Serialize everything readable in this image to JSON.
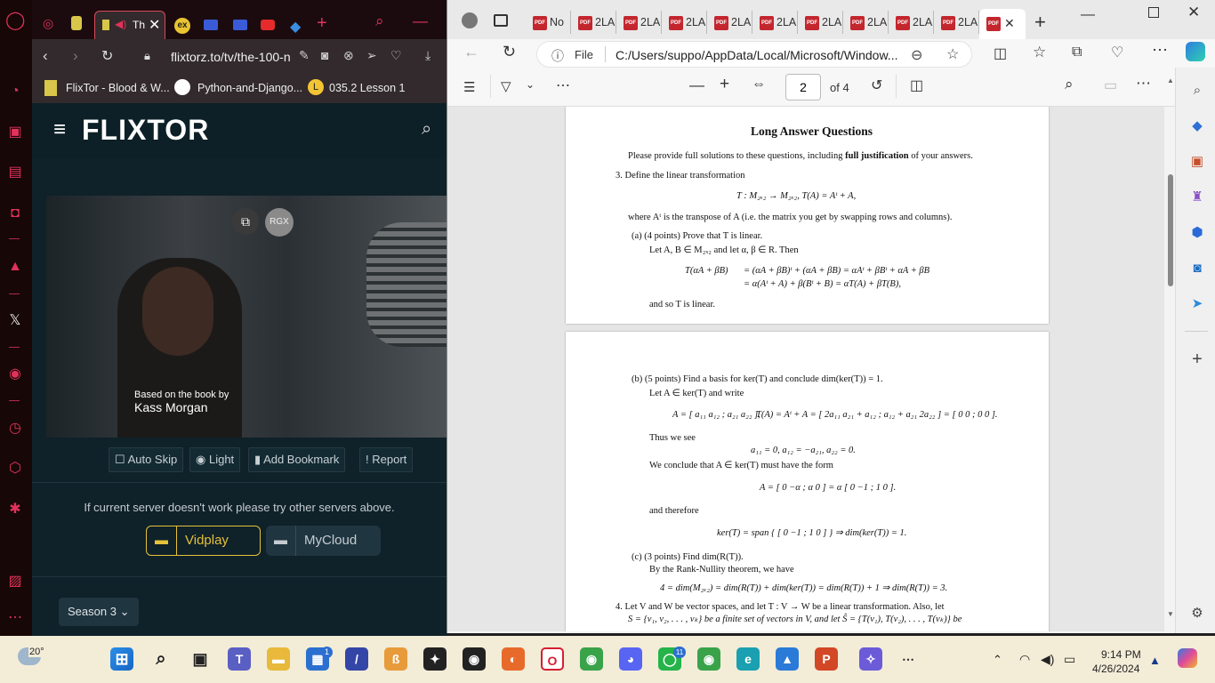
{
  "opera": {
    "tab_active_label": "Th",
    "address": "flixtorz.to/tv/the-100-n",
    "bookmarks": [
      {
        "label": "FlixTor - Blood & W..."
      },
      {
        "label": "Python-and-Django..."
      },
      {
        "label": "035.2 Lesson 1"
      }
    ]
  },
  "flixtor": {
    "logo": "FLIXTOR",
    "video": {
      "credit_line1": "Based on the book by",
      "credit_line2": "Kass Morgan",
      "badge": "RGX"
    },
    "controls": {
      "auto_skip": "Auto Skip",
      "light": "Light",
      "add_bookmark": "Add Bookmark",
      "report": "Report"
    },
    "server_notice": "If current server doesn't work please try other servers above.",
    "servers": [
      {
        "label": "Vidplay",
        "active": true
      },
      {
        "label": "MyCloud",
        "active": false
      }
    ],
    "season_select": "Season 3"
  },
  "edge": {
    "tabs": [
      {
        "label": "No"
      },
      {
        "label": "2LA"
      },
      {
        "label": "2LA"
      },
      {
        "label": "2LA"
      },
      {
        "label": "2LA"
      },
      {
        "label": "2LA"
      },
      {
        "label": "2LA"
      },
      {
        "label": "2LA"
      },
      {
        "label": "2LA"
      },
      {
        "label": "2LA"
      }
    ],
    "address_prefix": "File",
    "address": "C:/Users/suppo/AppData/Local/Microsoft/Window...",
    "pdf": {
      "page_current": "2",
      "page_total": "of 4"
    }
  },
  "document": {
    "page1": {
      "heading": "Long Answer Questions",
      "intro_pre": "Please provide full solutions to these questions, including ",
      "intro_bold": "full justification",
      "intro_post": " of your answers.",
      "q3": "3.  Define the linear transformation",
      "q3_eq": "T : M₂ₓ₂ → M₂ₓ₂,      T(A) = Aᵗ + A,",
      "q3_where": "where Aᵗ is the transpose of A (i.e. the matrix you get by swapping rows and columns).",
      "qa": "(a)  (4 points) Prove that T is linear.",
      "qa_let": "Let A, B ∈ M₂ₓ₂ and let α, β ∈ R.  Then",
      "qa_eq1_lhs": "T(αA + βB)",
      "qa_eq1_rhs": "=   (αA + βB)ᵗ + (αA + βB) = αAᵗ + βBᵗ + αA + βB",
      "qa_eq2_rhs": "=   α(Aᵗ + A) + β(Bᵗ + B) = αT(A) + βT(B),",
      "qa_conc": "and so T is linear."
    },
    "page2": {
      "qb": "(b)  (5 points) Find a basis for ker(T) and conclude dim(ker(T)) = 1.",
      "qb_let": "Let A ∈ ker(T) and write",
      "qb_mat_a": "A = [ a₁₁  a₁₂ ; a₂₁  a₂₂ ],",
      "qb_mat_t": "T(A) = Aᵗ + A = [ 2a₁₁   a₂₁ + a₁₂ ; a₁₂ + a₂₁   2a₂₂ ] = [ 0 0 ; 0 0 ].",
      "qb_thus": "Thus we see",
      "qb_vals": "a₁₁ = 0,        a₁₂ = −a₂₁,        a₂₂ = 0.",
      "qb_concl": "We conclude that A ∈ ker(T) must have the form",
      "qb_form": "A = [ 0  −α ; α  0 ] = α [ 0  −1 ; 1  0 ].",
      "qb_therefore": "and therefore",
      "qb_ker": "ker(T) = span { [ 0  −1 ; 1  0 ] }    ⇒    dim(ker(T)) = 1.",
      "qc": "(c)  (3 points) Find dim(R(T)).",
      "qc_by": "By the Rank-Nullity theorem, we have",
      "qc_eq": "4 = dim(M₂ₓ₂) = dim(R(T)) + dim(ker(T)) = dim(R(T)) + 1 ⇒ dim(R(T)) = 3.",
      "q4_l1": "4.  Let V and W be vector spaces, and let T : V → W be a linear transformation.  Also, let",
      "q4_l2": "S = {v₁, v₂, . . . , vₖ} be a finite set of vectors in V, and let Ŝ = {T(v₁), T(v₂), . . . , T(vₖ)} be"
    }
  },
  "taskbar": {
    "weather_temp": "20°",
    "time": "9:14 PM",
    "date": "4/26/2024",
    "badges": {
      "store": "1",
      "whatsapp": "11"
    }
  }
}
